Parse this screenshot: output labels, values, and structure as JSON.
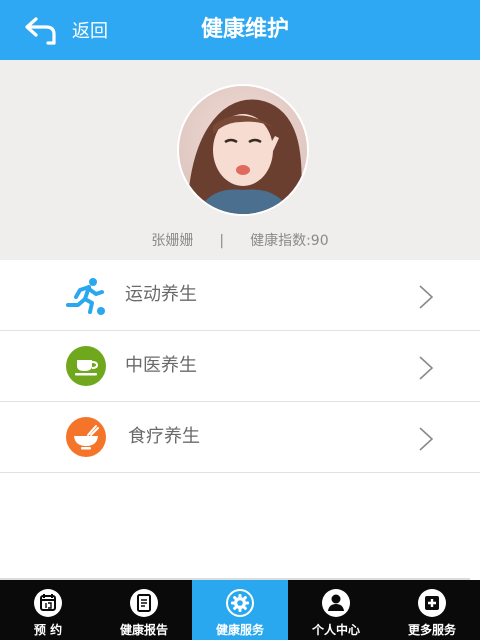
{
  "header": {
    "back_label": "返回",
    "title": "健康维护",
    "background": "#2ea8f2"
  },
  "profile": {
    "name": "张姗姗",
    "separator": "|",
    "health_index": "健康指数:90"
  },
  "menu": {
    "items": [
      {
        "label": "运动养生",
        "icon": "running-icon",
        "icon_color": "#29a8f0"
      },
      {
        "label": "中医养生",
        "icon": "teacup-icon",
        "icon_color": "#6fa81c"
      },
      {
        "label": "食疗养生",
        "icon": "bowl-icon",
        "icon_color": "#f4742a"
      }
    ]
  },
  "tabbar": {
    "active_color": "#29a8f0",
    "items": [
      {
        "label": "预 约",
        "icon": "calendar-icon",
        "active": false
      },
      {
        "label": "健康报告",
        "icon": "report-icon",
        "active": false
      },
      {
        "label": "健康服务",
        "icon": "gear-icon",
        "active": true
      },
      {
        "label": "个人中心",
        "icon": "user-icon",
        "active": false
      },
      {
        "label": "更多服务",
        "icon": "plus-icon",
        "active": false
      }
    ]
  }
}
